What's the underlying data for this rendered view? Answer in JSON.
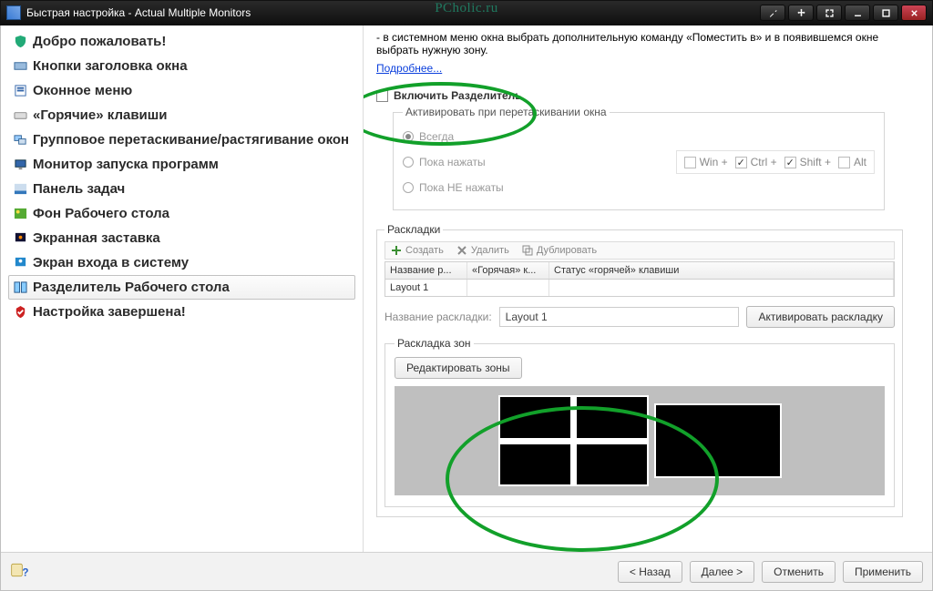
{
  "watermark": "PCholic.ru",
  "window": {
    "title": "Быстрая настройка - Actual Multiple Monitors"
  },
  "sysbuttons": [
    {
      "name": "wrench-icon",
      "glyph": "wrench"
    },
    {
      "name": "move-icon",
      "glyph": "move"
    },
    {
      "name": "collapse-icon",
      "glyph": "expand"
    },
    {
      "name": "minimize-icon",
      "glyph": "min"
    },
    {
      "name": "maximize-icon",
      "glyph": "max"
    },
    {
      "name": "close-icon",
      "glyph": "close"
    }
  ],
  "sidebar": {
    "items": [
      {
        "icon": "shield",
        "label": "Добро пожаловать!"
      },
      {
        "icon": "titlebtns",
        "label": "Кнопки заголовка окна"
      },
      {
        "icon": "winmenu",
        "label": "Оконное меню"
      },
      {
        "icon": "hotkeys",
        "label": "«Горячие» клавиши"
      },
      {
        "icon": "groupdrag",
        "label": "Групповое перетаскивание/растягивание окон"
      },
      {
        "icon": "monitor",
        "label": "Монитор запуска программ"
      },
      {
        "icon": "taskbar",
        "label": "Панель задач"
      },
      {
        "icon": "wallpaper",
        "label": "Фон Рабочего стола"
      },
      {
        "icon": "screensaver",
        "label": "Экранная заставка"
      },
      {
        "icon": "logon",
        "label": "Экран входа в систему"
      },
      {
        "icon": "divider",
        "label": "Разделитель Рабочего стола"
      },
      {
        "icon": "done",
        "label": "Настройка завершена!"
      }
    ],
    "selected_index": 10
  },
  "content": {
    "intro": "- в системном меню окна выбрать дополнительную команду «Поместить в» и в появившемся окне выбрать нужную зону.",
    "more_link": "Подробнее...",
    "enable_divider_label": "Включить Разделитель",
    "activation": {
      "legend": "Активировать при перетаскивании окна",
      "always": "Всегда",
      "while_pressed": "Пока нажаты",
      "while_not_pressed": "Пока НЕ нажаты",
      "keys": {
        "win": "Win +",
        "ctrl": "Ctrl +",
        "shift": "Shift +",
        "alt": "Alt"
      }
    },
    "layouts": {
      "legend": "Раскладки",
      "toolbar": {
        "create": "Создать",
        "delete": "Удалить",
        "duplicate": "Дублировать"
      },
      "columns": {
        "c1": "Название р...",
        "c2": "«Горячая» к...",
        "c3": "Статус «горячей» клавиши"
      },
      "rows": [
        {
          "name": "Layout 1",
          "hotkey": "",
          "status": ""
        }
      ],
      "name_field_label": "Название раскладки:",
      "name_field_value": "Layout 1",
      "activate_btn": "Активировать раскладку"
    },
    "zones": {
      "legend": "Раскладка зон",
      "edit_btn": "Редактировать зоны"
    }
  },
  "footer": {
    "back": "< Назад",
    "next": "Далее >",
    "cancel": "Отменить",
    "apply": "Применить"
  }
}
